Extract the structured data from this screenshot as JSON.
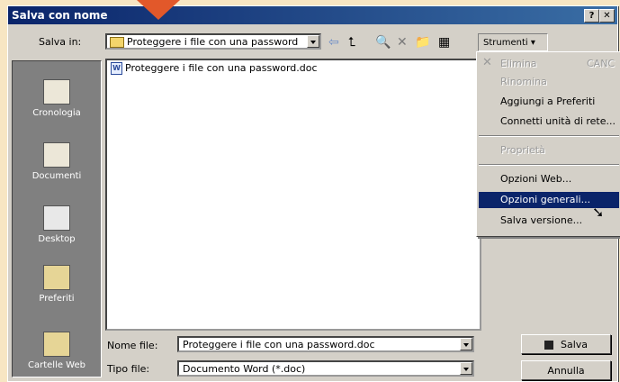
{
  "window": {
    "title": "Salva con nome",
    "help_btn": "?",
    "close_btn": "✕"
  },
  "save_in": {
    "label": "Salva in:",
    "value": "Proteggere i file con una password"
  },
  "toolbar": {
    "tools_label": "Strumenti ▾"
  },
  "places": [
    {
      "label": "Cronologia",
      "icon": "history-icon"
    },
    {
      "label": "Documenti",
      "icon": "documents-icon"
    },
    {
      "label": "Desktop",
      "icon": "desktop-icon"
    },
    {
      "label": "Preferiti",
      "icon": "favorites-icon"
    },
    {
      "label": "Cartelle Web",
      "icon": "web-folders-icon"
    }
  ],
  "files": [
    {
      "name": "Proteggere i file con una password.doc"
    }
  ],
  "menu": {
    "items": [
      {
        "label": "Elimina",
        "shortcut": "CANC",
        "disabled": true
      },
      {
        "label": "Rinomina",
        "disabled": true
      },
      {
        "label": "Aggiungi a Preferiti",
        "disabled": false
      },
      {
        "label": "Connetti unità di rete...",
        "disabled": false
      },
      {
        "label": "Proprietà",
        "disabled": true
      },
      {
        "label": "Opzioni Web...",
        "disabled": false
      },
      {
        "label": "Opzioni generali...",
        "disabled": false,
        "highlighted": true
      },
      {
        "label": "Salva versione...",
        "disabled": false
      }
    ]
  },
  "filename": {
    "label": "Nome file:",
    "value": "Proteggere i file con una password.doc"
  },
  "filetype": {
    "label": "Tipo file:",
    "value": "Documento Word (*.doc)"
  },
  "buttons": {
    "save": "Salva",
    "cancel": "Annulla"
  },
  "colors": {
    "titlebar": "#0a246a",
    "highlight": "#0a246a",
    "arrow": "#e2582a",
    "background": "#f7e6c3"
  }
}
